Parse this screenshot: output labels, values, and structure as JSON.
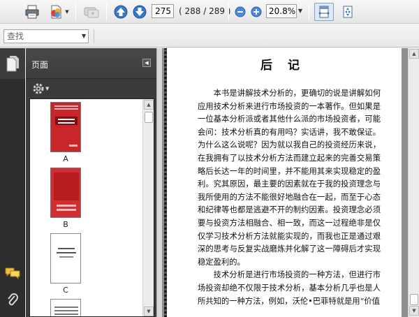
{
  "toolbar": {
    "print_icon": "printer-icon",
    "create_icon": "create-pdf-icon",
    "share_icon": "share-icon",
    "prev_icon": "arrow-up-icon",
    "next_icon": "arrow-down-icon",
    "page_number": "275",
    "page_count": "( 288 / 289 )",
    "zoom_out_icon": "zoom-out-icon",
    "zoom_in_icon": "zoom-in-icon",
    "zoom_value": "20.8%",
    "fit_width_icon": "fit-width-icon",
    "fit_page_icon": "fit-page-icon"
  },
  "findbar": {
    "placeholder": "查找"
  },
  "sidebar": {
    "panel_title": "页面",
    "options_icon": "gear-icon",
    "thumbnails": [
      {
        "label": "A"
      },
      {
        "label": "B"
      },
      {
        "label": "C"
      }
    ],
    "rail_icons": [
      "pages-icon",
      "comments-icon",
      "attachment-icon"
    ]
  },
  "document": {
    "title": "后 记",
    "paragraphs": [
      "本书是讲解技术分析的，更确切的说是讲解如何应用技术分析来进行市场投资的一本著作。但如果是一位基本分析派或者其他什么派的市场投资者，可能会问：技术分析真的有用吗？实话讲，我不敢保证。为什么这么说呢？因为就以我自己的投资经历来说，在我拥有了以技术分析方法而建立起来的完善交易策略后长达一年的时间里，并不能用其来实现稳定的盈利。究其原因，最主要的因素就在于我的投资理念与我所使用的方法不能很好地融合在一起，而至于心态和纪律等也都是逃避不开的制约因素。投资理念必须要与投资方法相融合、相一致，而这一过程绝非是仅仅学习技术分析方法就能实现的，而我也正是通过艰深的思考与反复实战磨炼并化解了这一障碍后才实现稳定盈利的。",
      "技术分析是进行市场投资的一种方法，但进行市场投资却绝不仅限于技术分析，基本分析几乎也是人所共知的一种方法，例如，沃伦•巴菲特就是用“价值"
    ]
  },
  "colors": {
    "accent": "#3a78c9",
    "panel_dark": "#3a3a3a",
    "cover_red": "#c8262b"
  }
}
